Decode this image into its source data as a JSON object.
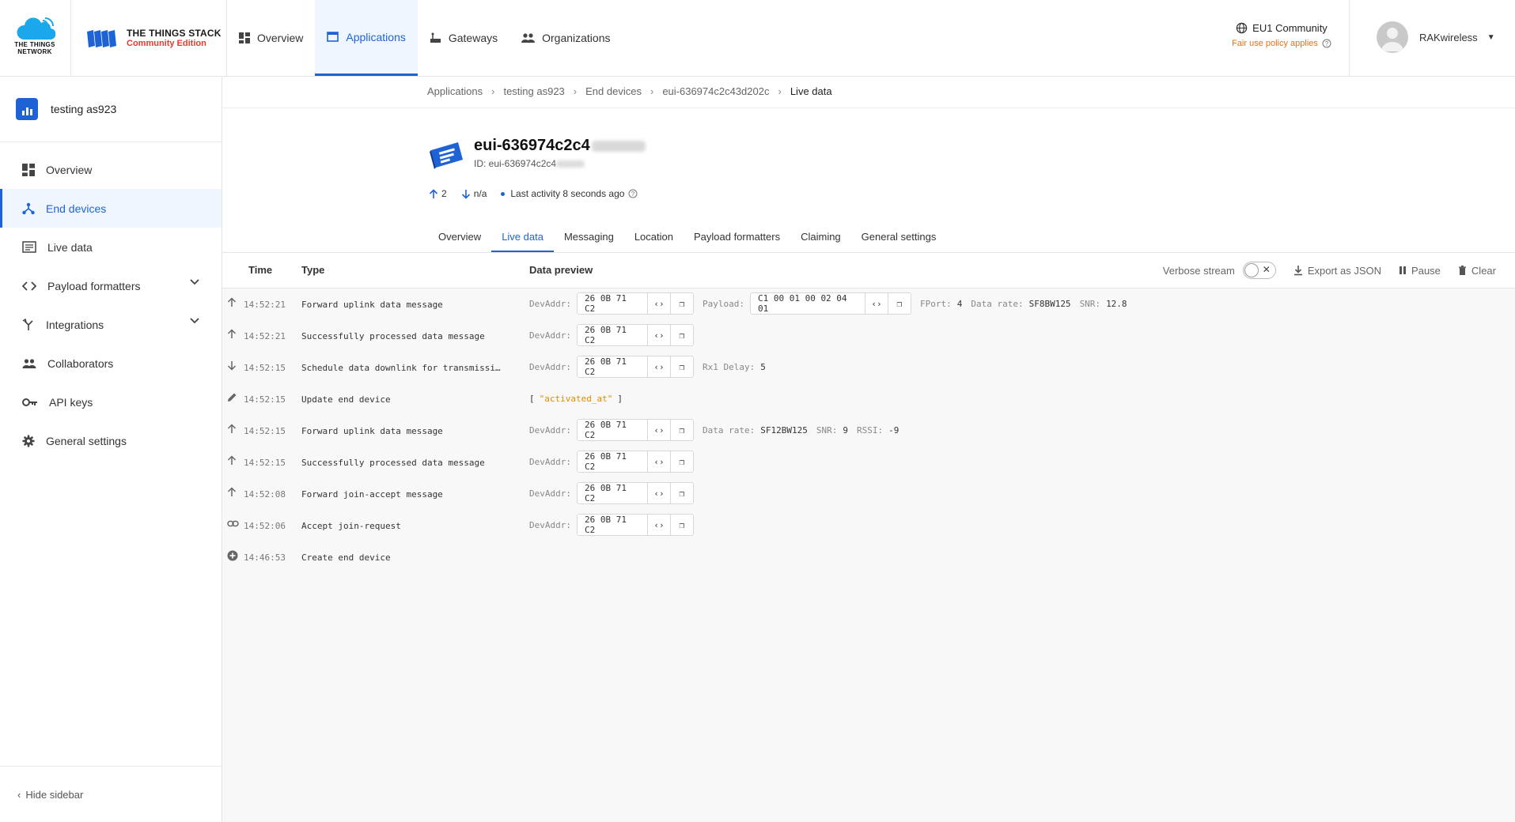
{
  "header": {
    "ttn_logo_text_1": "THE THINGS",
    "ttn_logo_text_2": "NETWORK",
    "tts_title": "THE THINGS STACK",
    "tts_subtitle": "Community Edition",
    "nav": [
      {
        "label": "Overview",
        "icon": "grid-icon"
      },
      {
        "label": "Applications",
        "icon": "application-icon"
      },
      {
        "label": "Gateways",
        "icon": "gateway-icon"
      },
      {
        "label": "Organizations",
        "icon": "people-icon"
      }
    ],
    "region": "EU1 Community",
    "fair_use": "Fair use policy applies",
    "username": "RAKwireless"
  },
  "sidebar": {
    "app_name": "testing as923",
    "items": [
      {
        "label": "Overview"
      },
      {
        "label": "End devices"
      },
      {
        "label": "Live data"
      },
      {
        "label": "Payload formatters"
      },
      {
        "label": "Integrations"
      },
      {
        "label": "Collaborators"
      },
      {
        "label": "API keys"
      },
      {
        "label": "General settings"
      }
    ],
    "hide_label": "Hide sidebar"
  },
  "breadcrumb": [
    "Applications",
    "testing as923",
    "End devices",
    "eui-636974c2c43d202c",
    "Live data"
  ],
  "device": {
    "title": "eui-636974c2c4",
    "id_label": "ID: eui-636974c2c4",
    "uplink_count": "2",
    "downlink_count": "n/a",
    "last_activity": "Last activity 8 seconds ago"
  },
  "tabs": [
    "Overview",
    "Live data",
    "Messaging",
    "Location",
    "Payload formatters",
    "Claiming",
    "General settings"
  ],
  "live_data": {
    "columns": {
      "time": "Time",
      "type": "Type",
      "preview": "Data preview"
    },
    "verbose_label": "Verbose stream",
    "export_label": "Export as JSON",
    "pause_label": "Pause",
    "clear_label": "Clear",
    "rows": [
      {
        "icon": "arrow-up-icon",
        "time": "14:52:21",
        "type": "Forward uplink data message",
        "devaddr": "26 0B 71 C2",
        "payload": "C1 00 01 00 02 04 01",
        "fport_label": "FPort:",
        "fport": "4",
        "dr_label": "Data rate:",
        "dr": "SF8BW125",
        "snr_label": "SNR:",
        "snr": "12.8"
      },
      {
        "icon": "arrow-up-icon",
        "time": "14:52:21",
        "type": "Successfully processed data message",
        "devaddr": "26 0B 71 C2"
      },
      {
        "icon": "arrow-down-icon",
        "time": "14:52:15",
        "type": "Schedule data downlink for transmissi…",
        "devaddr": "26 0B 71 C2",
        "rx_label": "Rx1 Delay:",
        "rx": "5"
      },
      {
        "icon": "pencil-icon",
        "time": "14:52:15",
        "type": "Update end device",
        "fields": "\"activated_at\""
      },
      {
        "icon": "arrow-up-icon",
        "time": "14:52:15",
        "type": "Forward uplink data message",
        "devaddr": "26 0B 71 C2",
        "dr_label": "Data rate:",
        "dr": "SF12BW125",
        "snr_label": "SNR:",
        "snr": "9",
        "rssi_label": "RSSI:",
        "rssi": "-9"
      },
      {
        "icon": "arrow-up-icon",
        "time": "14:52:15",
        "type": "Successfully processed data message",
        "devaddr": "26 0B 71 C2"
      },
      {
        "icon": "arrow-up-icon",
        "time": "14:52:08",
        "type": "Forward join-accept message",
        "devaddr": "26 0B 71 C2"
      },
      {
        "icon": "link-icon",
        "time": "14:52:06",
        "type": "Accept join-request",
        "devaddr": "26 0B 71 C2"
      },
      {
        "icon": "plus-circle-icon",
        "time": "14:46:53",
        "type": "Create end device"
      }
    ],
    "devaddr_label": "DevAddr:",
    "payload_label": "Payload:"
  },
  "colors": {
    "accent": "#1e63d6",
    "warning": "#e0731b",
    "brand_red": "#e53935"
  }
}
